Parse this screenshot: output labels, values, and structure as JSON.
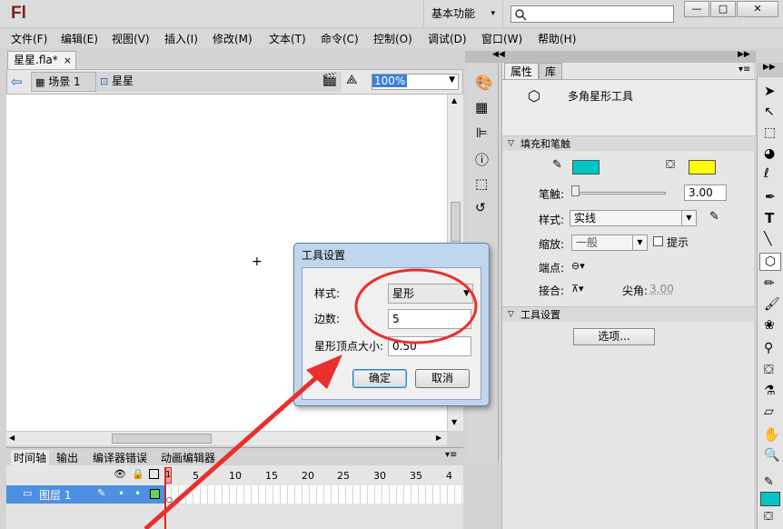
{
  "app": {
    "logo": "Fl",
    "workspace": "基本功能",
    "search_placeholder": ""
  },
  "window_controls": {
    "minimize": "—",
    "maximize": "□",
    "close": "✕"
  },
  "menu": [
    "文件(F)",
    "编辑(E)",
    "视图(V)",
    "插入(I)",
    "修改(M)",
    "文本(T)",
    "命令(C)",
    "控制(O)",
    "调试(D)",
    "窗口(W)",
    "帮助(H)"
  ],
  "document": {
    "tab_label": "星星.fla*",
    "scene": "场景 1",
    "symbol": "星星",
    "zoom": "100%"
  },
  "timeline": {
    "tabs": [
      "时间轴",
      "输出",
      "编译器错误",
      "动画编辑器"
    ],
    "frame_numbers": [
      "1",
      "5",
      "10",
      "15",
      "20",
      "25",
      "30",
      "35",
      "4"
    ],
    "layer_name": "图层 1"
  },
  "properties": {
    "tabs": [
      "属性",
      "库"
    ],
    "tool_name": "多角星形工具",
    "fill_stroke_section": "填充和笔触",
    "stroke_color": "#00c5c5",
    "fill_color": "#ffff00",
    "stroke_label": "笔触:",
    "stroke_value": "3.00",
    "style_label": "样式:",
    "style_value": "实线",
    "scale_label": "缩放:",
    "scale_value": "一般",
    "hint_label": "提示",
    "cap_label": "端点:",
    "join_label": "接合:",
    "miter_label": "尖角:",
    "miter_value": "3.00",
    "tool_settings_section": "工具设置",
    "options_button": "选项..."
  },
  "dialog": {
    "title": "工具设置",
    "style_label": "样式:",
    "style_value": "星形",
    "sides_label": "边数:",
    "sides_value": "5",
    "point_size_label": "星形顶点大小:",
    "point_size_value": "0.50",
    "ok": "确定",
    "cancel": "取消"
  },
  "annotation_color": "#e8302c"
}
